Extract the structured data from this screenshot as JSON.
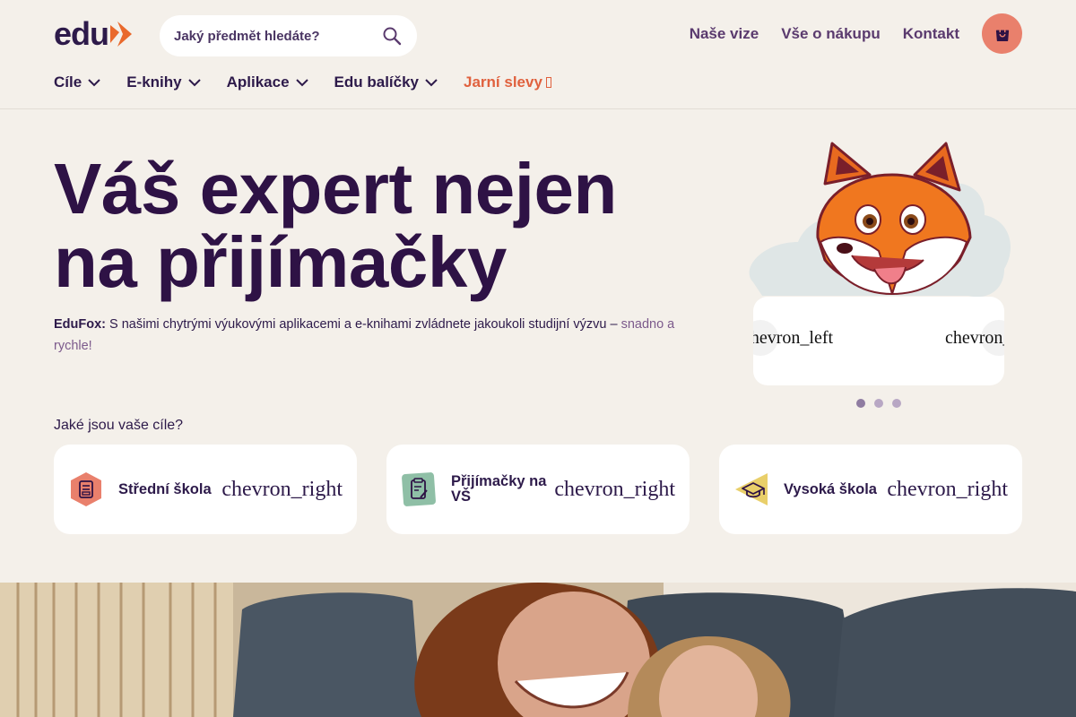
{
  "header": {
    "logo_text": "edu",
    "search": {
      "placeholder": "Jaký předmět hledáte?"
    },
    "links": [
      "Naše vize",
      "Vše o nákupu",
      "Kontakt"
    ]
  },
  "nav": {
    "items": [
      "Cíle",
      "E-knihy",
      "Aplikace",
      "Edu balíčky"
    ],
    "sale": "Jarní slevy"
  },
  "hero": {
    "title_line1": "Váš expert nejen",
    "title_line2": "na přijímačky",
    "desc_brand": "EduFox:",
    "desc_text": " S našimi chytrými výukovými aplikacemi a e-knihami zvládnete jakoukoli studijní výzvu – ",
    "desc_accent": "snadno a rychle!"
  },
  "carousel": {
    "left_label": "chevron_left",
    "right_label": "chevron_right",
    "dots": 3
  },
  "goals": {
    "label": "Jaké jsou vaše cíle?",
    "chevron": "chevron_right",
    "items": [
      {
        "label": "Střední škola",
        "icon": "school-book-icon",
        "color": "#e9806c"
      },
      {
        "label": "Přijímačky na VŠ",
        "icon": "clipboard-pen-icon",
        "color": "#8fbfa6"
      },
      {
        "label": "Vysoká škola",
        "icon": "graduation-cap-icon",
        "color": "#e9cf6a"
      }
    ]
  },
  "colors": {
    "brand": "#2e1245",
    "accent": "#e9806c",
    "sale": "#e0613e",
    "background": "#f4f0ea"
  }
}
